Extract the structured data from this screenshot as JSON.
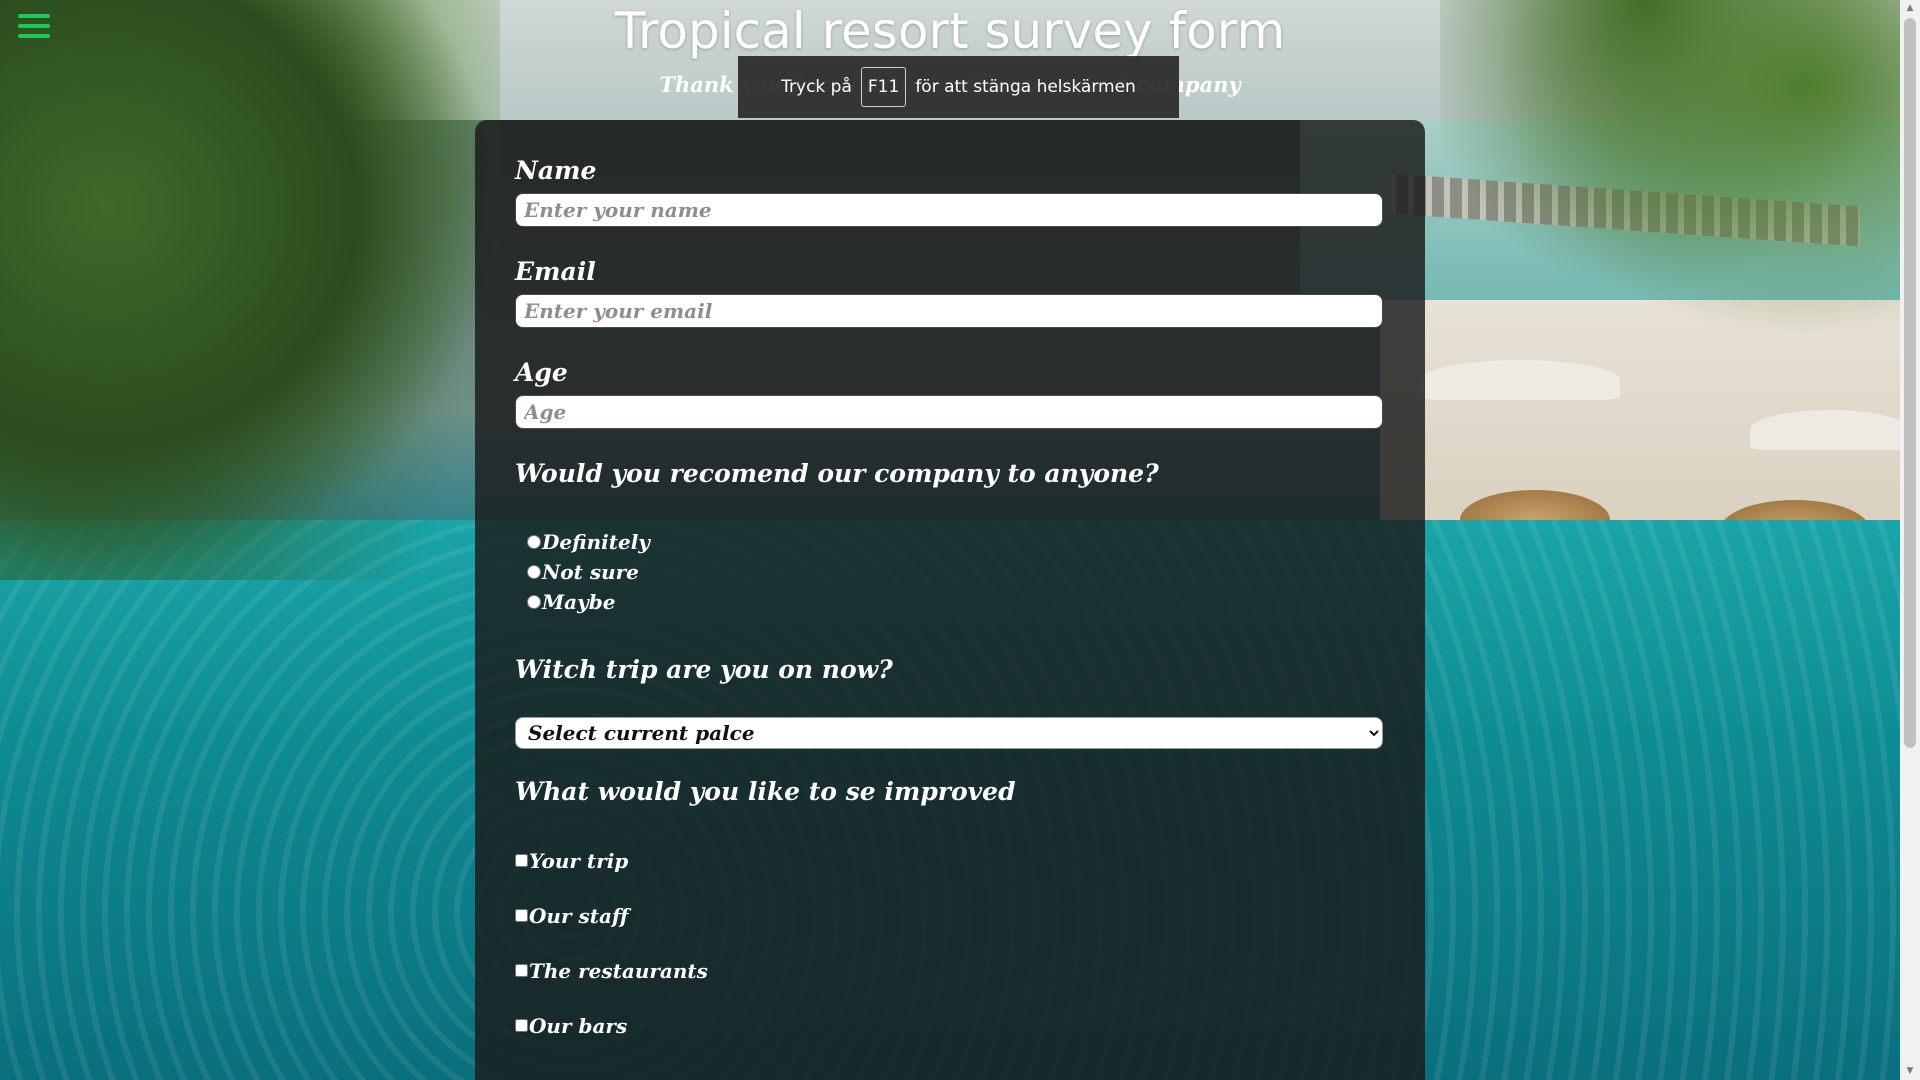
{
  "header": {
    "title": "Tropical resort survey form",
    "subtitle": "Thank you for your time with our resort company"
  },
  "fullscreen_notice": {
    "prefix": "Tryck på",
    "key": "F11",
    "suffix": "för att stänga helskärmen"
  },
  "form": {
    "name": {
      "label": "Name",
      "placeholder": "Enter your name"
    },
    "email": {
      "label": "Email",
      "placeholder": "Enter your email"
    },
    "age": {
      "label": "Age",
      "placeholder": "Age"
    },
    "recommend": {
      "question": "Would you recomend our company to anyone?",
      "options": [
        "Definitely",
        "Not sure",
        "Maybe"
      ]
    },
    "trip": {
      "question": "Witch trip are you on now?",
      "selected": "Select current palce"
    },
    "improve": {
      "question": "What would you like to se improved",
      "options": [
        "Your trip",
        "Our staff",
        "The restaurants",
        "Our bars"
      ]
    }
  },
  "colors": {
    "hamburger": "#1ec85a",
    "card_background": "rgba(26,26,26,0.82)",
    "text": "#ffffff"
  },
  "icons": {
    "menu": "hamburger-menu-icon",
    "select": "chevron-down-icon"
  }
}
